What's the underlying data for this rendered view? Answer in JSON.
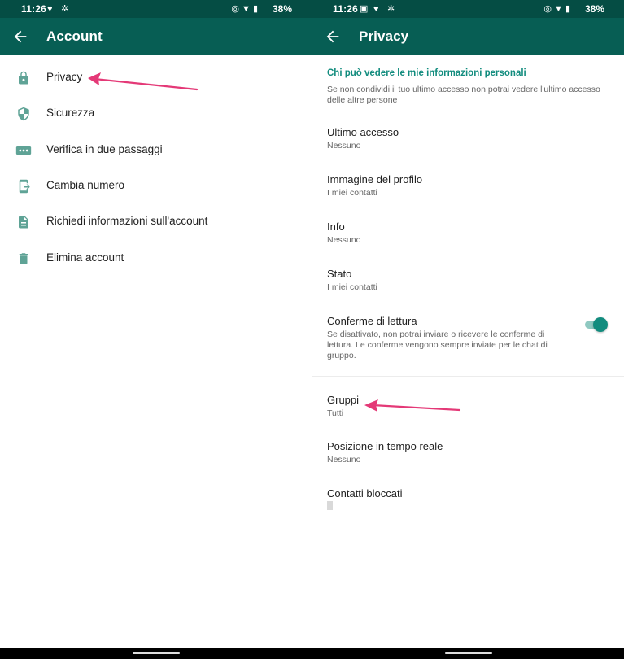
{
  "colors": {
    "statusbar": "#054d44",
    "appbar": "#075e54",
    "accent": "#128c7e",
    "arrow": "#e43977",
    "toggle_on": "#128c7e"
  },
  "left": {
    "status": {
      "time": "11:26",
      "battery": "38%"
    },
    "appbar": {
      "title": "Account"
    },
    "menu": [
      {
        "label": "Privacy",
        "icon": "lock-icon"
      },
      {
        "label": "Sicurezza",
        "icon": "shield-icon"
      },
      {
        "label": "Verifica in due passaggi",
        "icon": "dots-icon"
      },
      {
        "label": "Cambia numero",
        "icon": "phone-change-icon"
      },
      {
        "label": "Richiedi informazioni sull'account",
        "icon": "document-icon"
      },
      {
        "label": "Elimina account",
        "icon": "trash-icon"
      }
    ]
  },
  "right": {
    "status": {
      "time": "11:26",
      "battery": "38%"
    },
    "appbar": {
      "title": "Privacy"
    },
    "section": {
      "title": "Chi può vedere le mie informazioni personali",
      "description": "Se non condividi il tuo ultimo accesso non potrai vedere l'ultimo accesso delle altre persone"
    },
    "prefs": [
      {
        "title": "Ultimo accesso",
        "subtitle": "Nessuno"
      },
      {
        "title": "Immagine del profilo",
        "subtitle": "I miei contatti"
      },
      {
        "title": "Info",
        "subtitle": "Nessuno"
      },
      {
        "title": "Stato",
        "subtitle": "I miei contatti"
      },
      {
        "title": "Conferme di lettura",
        "subtitle": "Se disattivato, non potrai inviare o ricevere le conferme di lettura. Le conferme vengono sempre inviate per le chat di gruppo.",
        "toggle": true
      },
      {
        "title": "Gruppi",
        "subtitle": "Tutti"
      },
      {
        "title": "Posizione in tempo reale",
        "subtitle": "Nessuno"
      },
      {
        "title": "Contatti bloccati",
        "subtitle": ""
      }
    ]
  }
}
